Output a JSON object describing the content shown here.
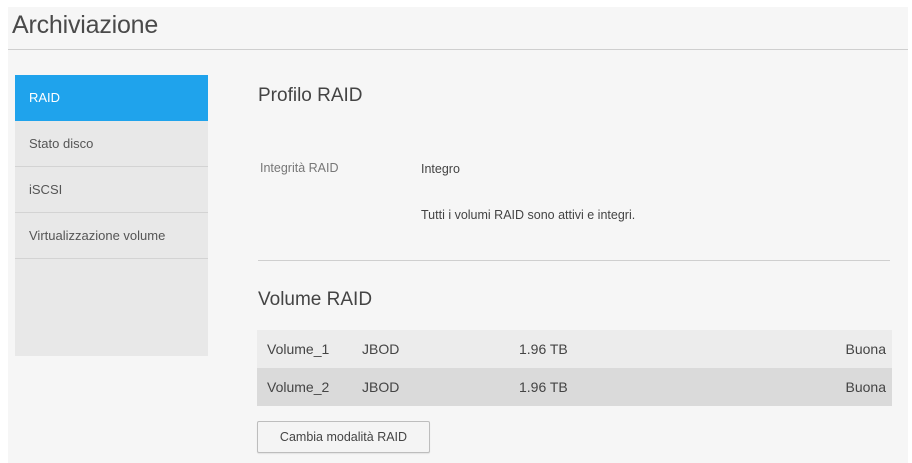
{
  "page": {
    "title": "Archiviazione"
  },
  "sidebar": {
    "items": [
      {
        "label": "RAID",
        "active": true
      },
      {
        "label": "Stato disco",
        "active": false
      },
      {
        "label": "iSCSI",
        "active": false
      },
      {
        "label": "Virtualizzazione volume",
        "active": false
      }
    ]
  },
  "raid_profile": {
    "title": "Profilo RAID",
    "integrity_label": "Integrità RAID",
    "integrity_value": "Integro",
    "integrity_message": "Tutti i volumi RAID sono attivi e integri."
  },
  "raid_volumes": {
    "title": "Volume RAID",
    "rows": [
      {
        "name": "Volume_1",
        "type": "JBOD",
        "size": "1.96 TB",
        "status": "Buona"
      },
      {
        "name": "Volume_2",
        "type": "JBOD",
        "size": "1.96 TB",
        "status": "Buona"
      }
    ]
  },
  "actions": {
    "change_mode_label": "Cambia modalità RAID"
  },
  "colors": {
    "accent": "#1fa3ec",
    "background": "#f6f6f6"
  }
}
